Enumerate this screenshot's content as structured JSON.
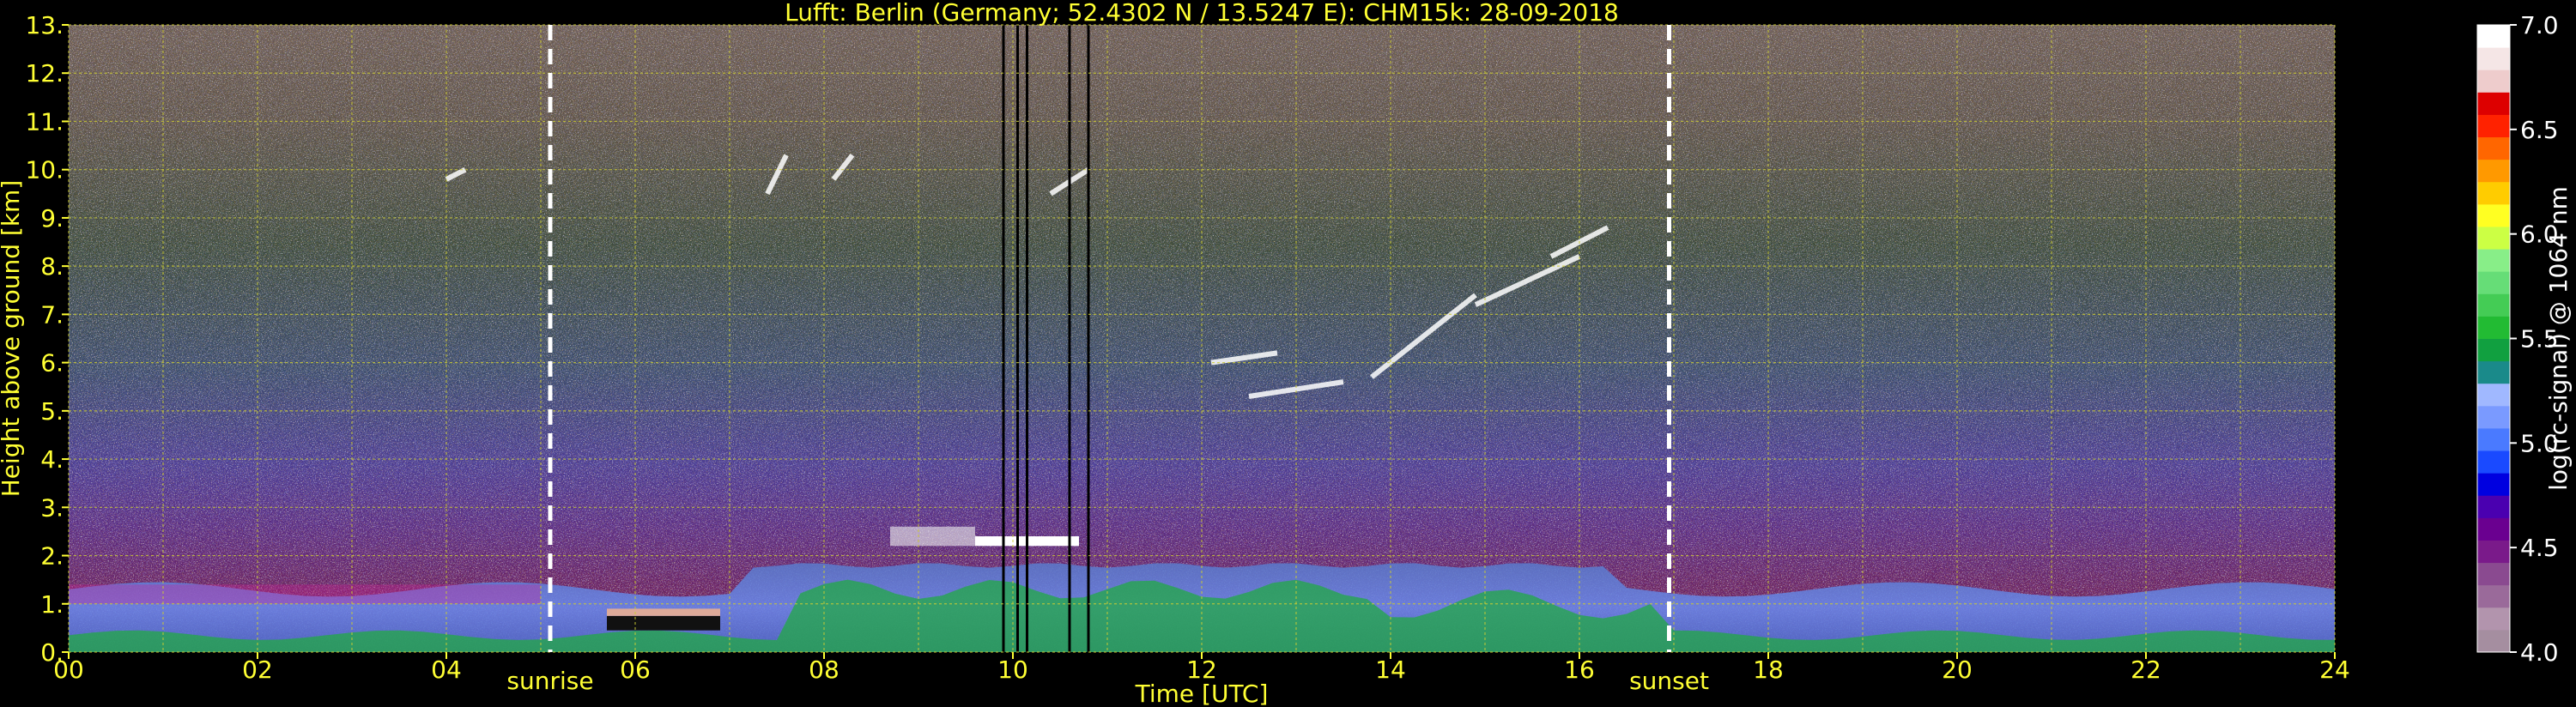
{
  "chart_data": {
    "type": "heatmap",
    "title": "Lufft: Berlin (Germany; 52.4302 N / 13.5247 E):    CHM15k: 28-09-2018",
    "xlabel": "Time [UTC]",
    "ylabel": "Height above ground [km]",
    "xlim": [
      0,
      24
    ],
    "ylim": [
      0,
      13
    ],
    "x_ticks": [
      "00",
      "02",
      "04",
      "06",
      "08",
      "10",
      "12",
      "14",
      "16",
      "18",
      "20",
      "22",
      "24"
    ],
    "y_ticks": [
      "0.",
      "1.",
      "2.",
      "3.",
      "4.",
      "5.",
      "6.",
      "7.",
      "8.",
      "9.",
      "10.",
      "11.",
      "12.",
      "13."
    ],
    "grid": true,
    "annotations": [
      {
        "label": "sunrise",
        "x": 5.1
      },
      {
        "label": "sunset",
        "x": 16.95
      }
    ],
    "colorbar": {
      "label": "log(rc-signal) @ 1064 nm",
      "range": [
        4.0,
        7.0
      ],
      "ticks": [
        "4.0",
        "4.5",
        "5.0",
        "5.5",
        "6.0",
        "6.5",
        "7.0"
      ],
      "colors": [
        "#a58ea0",
        "#b294ad",
        "#9a6a9a",
        "#8a4a90",
        "#7a1a8a",
        "#6a0090",
        "#4a00b0",
        "#0000e0",
        "#1a4aff",
        "#4a7aff",
        "#7a9aff",
        "#a0b8ff",
        "#1a8a8a",
        "#11a040",
        "#22bb33",
        "#44cc55",
        "#66dd77",
        "#88ee88",
        "#ccff44",
        "#ffff22",
        "#ffcc00",
        "#ff9900",
        "#ff6600",
        "#ff2200",
        "#dd0000",
        "#eecccc",
        "#f5e6e6",
        "#ffffff"
      ]
    },
    "features": {
      "boundary_layer_top_km": 1.8,
      "residual_layer_km": [
        2.2,
        2.6
      ],
      "cirrus_layer_km": [
        5.5,
        9.5
      ],
      "precip_streaks_hours": [
        9.9,
        10.05,
        10.15,
        10.6,
        10.8
      ]
    }
  }
}
